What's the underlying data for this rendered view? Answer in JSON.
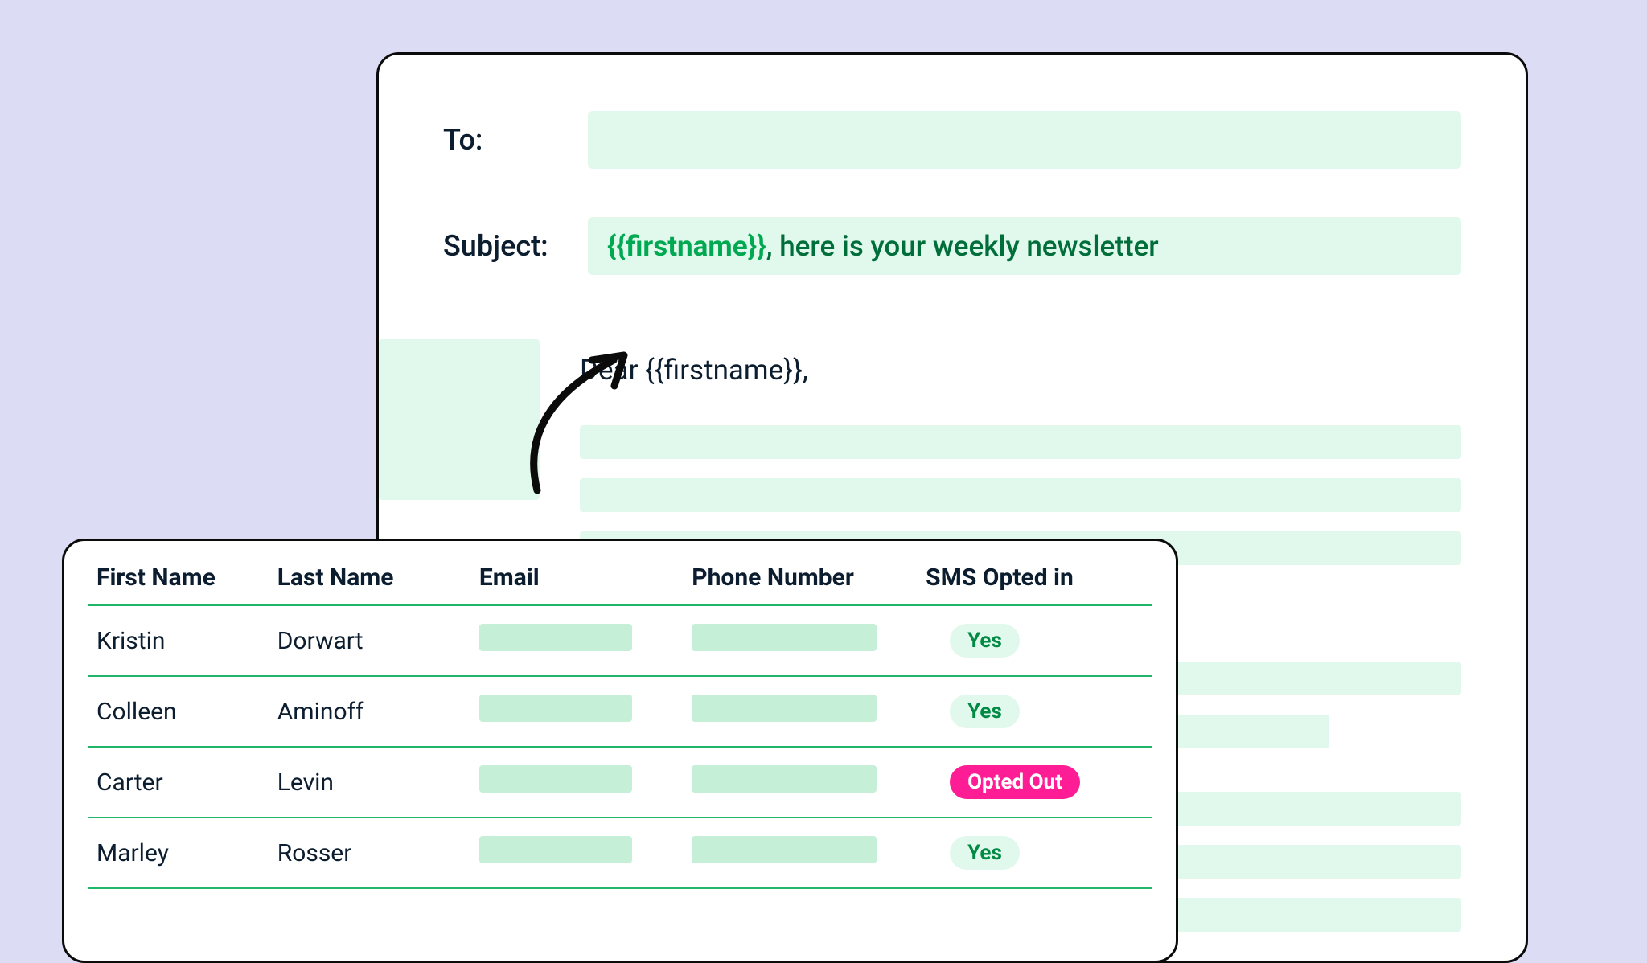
{
  "composer": {
    "to_label": "To:",
    "subject_label": "Subject:",
    "subject_variable": "{{firstname}}",
    "subject_suffix": ", here is your weekly newsletter",
    "greeting": "Dear {{firstname}},"
  },
  "table": {
    "headers": {
      "first_name": "First Name",
      "last_name": "Last Name",
      "email": "Email",
      "phone": "Phone Number",
      "sms": "SMS Opted in"
    },
    "rows": [
      {
        "first": "Kristin",
        "last": "Dorwart",
        "sms": "Yes",
        "sms_kind": "yes"
      },
      {
        "first": "Colleen",
        "last": "Aminoff",
        "sms": "Yes",
        "sms_kind": "yes"
      },
      {
        "first": "Carter",
        "last": "Levin",
        "sms": "Opted Out",
        "sms_kind": "out"
      },
      {
        "first": "Marley",
        "last": "Rosser",
        "sms": "Yes",
        "sms_kind": "yes"
      }
    ]
  }
}
